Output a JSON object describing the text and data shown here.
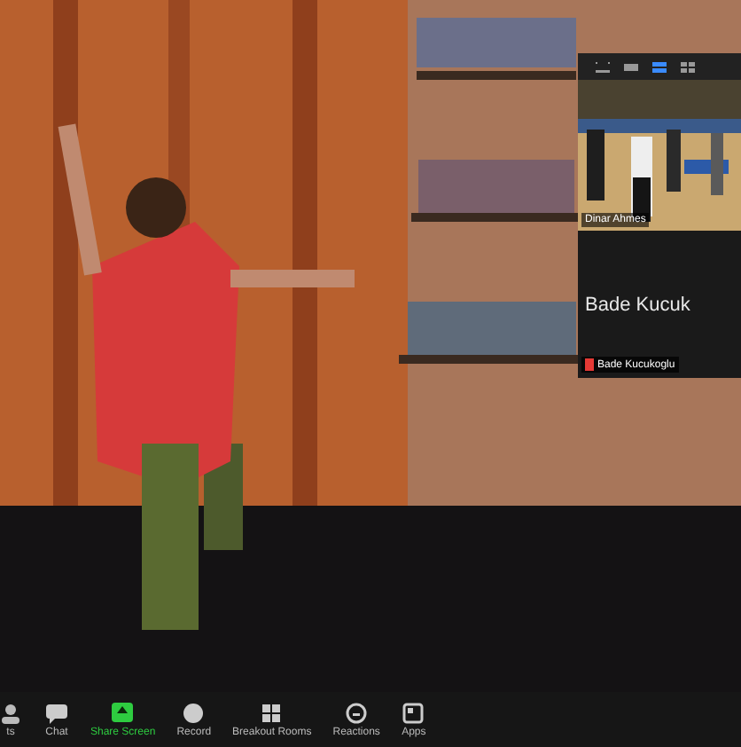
{
  "gallery": {
    "view_buttons": [
      {
        "kind": "minimize",
        "selected": false
      },
      {
        "kind": "strip",
        "selected": false
      },
      {
        "kind": "speaker",
        "selected": true
      },
      {
        "kind": "grid",
        "selected": false
      }
    ],
    "tiles": [
      {
        "kind": "video",
        "name": "Dinar Ahmes"
      },
      {
        "kind": "avatar",
        "display_name": "Bade Kucuk",
        "name": "Bade Kucukoglu",
        "muted": true
      }
    ]
  },
  "toolbar": {
    "items": [
      {
        "kind": "participants",
        "label": "ts",
        "highlighted": false
      },
      {
        "kind": "chat",
        "label": "Chat",
        "highlighted": false
      },
      {
        "kind": "share",
        "label": "Share Screen",
        "highlighted": true
      },
      {
        "kind": "record",
        "label": "Record",
        "highlighted": false
      },
      {
        "kind": "breakout",
        "label": "Breakout Rooms",
        "highlighted": false
      },
      {
        "kind": "reactions",
        "label": "Reactions",
        "highlighted": false
      },
      {
        "kind": "apps",
        "label": "Apps",
        "highlighted": false
      }
    ]
  }
}
